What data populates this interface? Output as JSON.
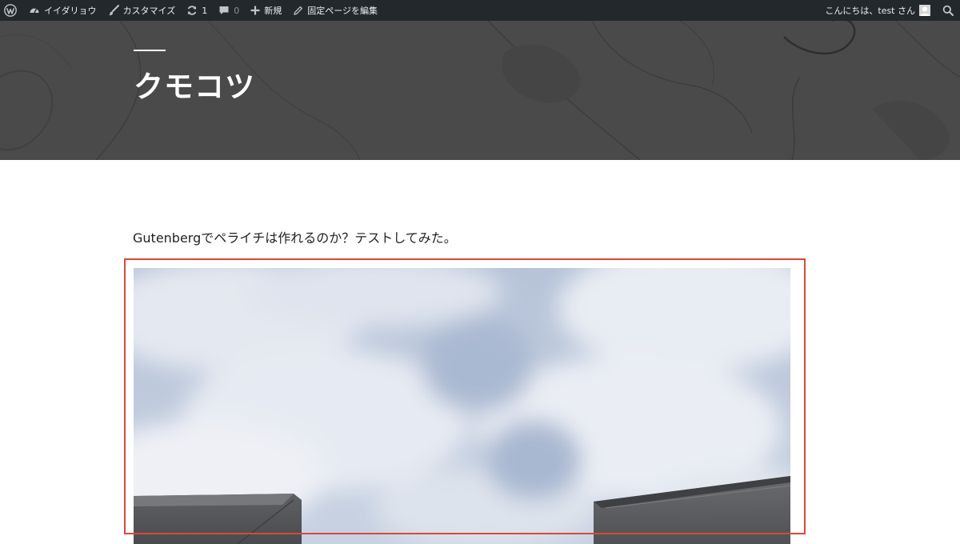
{
  "admin_bar": {
    "site_name": "イイダリョウ",
    "customize": "カスタマイズ",
    "updates_count": "1",
    "comments_count": "0",
    "new": "新規",
    "edit_page": "固定ページを編集",
    "greeting": "こんにちは、test さん"
  },
  "header": {
    "title": "クモコツ"
  },
  "content": {
    "intro_text": "Gutenbergでペライチは作れるのか？テストしてみた。"
  },
  "colors": {
    "admin_bar_bg": "#23282d",
    "header_bg": "#4a4a4a",
    "highlight_border": "#d9483b"
  },
  "icons": [
    "wordpress-logo-icon",
    "dashboard-icon",
    "brush-icon",
    "updates-icon",
    "comment-icon",
    "plus-icon",
    "pencil-icon",
    "avatar",
    "search-icon"
  ]
}
